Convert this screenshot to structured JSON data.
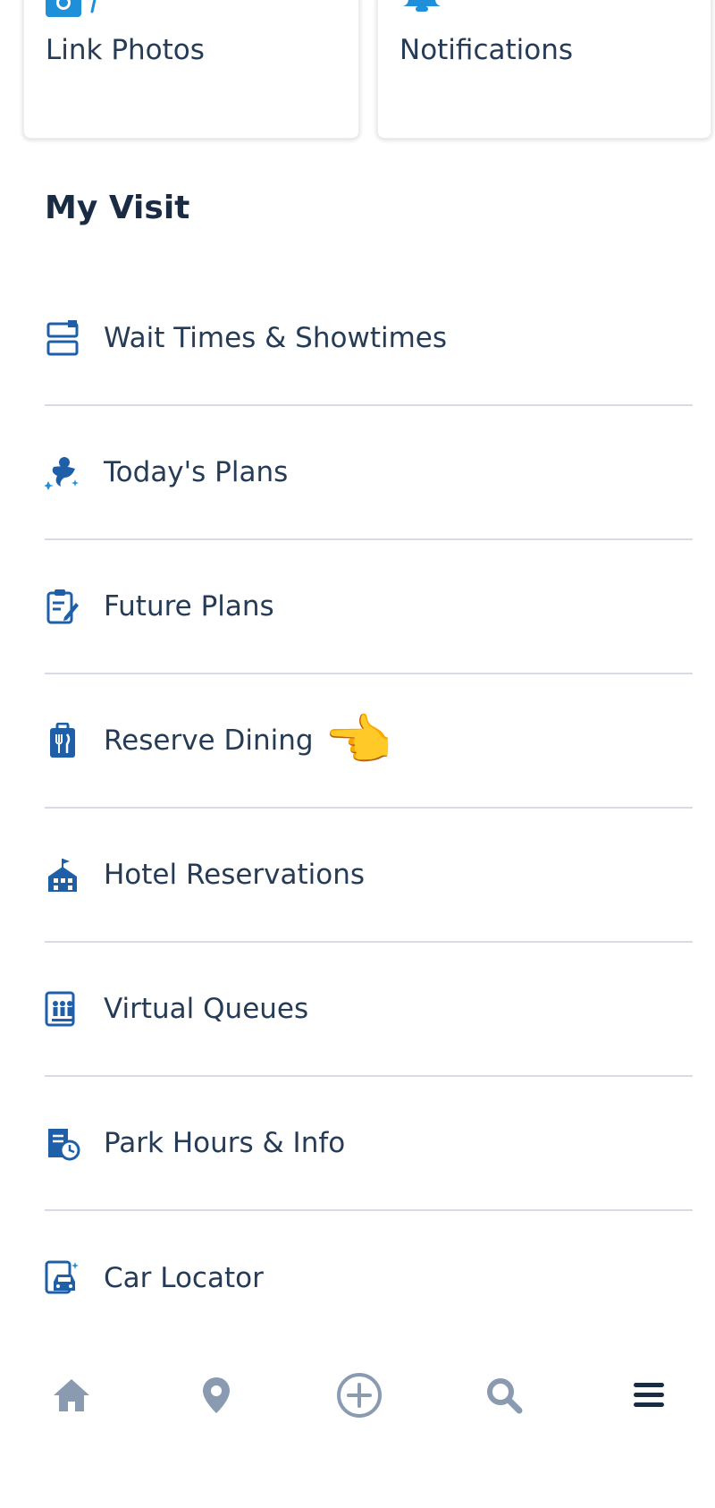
{
  "top_cards": [
    {
      "label": "Link Photos",
      "icon": "photo-link-icon"
    },
    {
      "label": "Notifications",
      "icon": "bell-icon"
    }
  ],
  "section": {
    "title": "My Visit"
  },
  "menu_items": [
    {
      "label": "Wait Times & Showtimes",
      "icon": "wait-times-icon"
    },
    {
      "label": "Today's Plans",
      "icon": "genie-icon"
    },
    {
      "label": "Future Plans",
      "icon": "clipboard-edit-icon"
    },
    {
      "label": "Reserve Dining",
      "icon": "dining-icon",
      "emoji": "👈"
    },
    {
      "label": "Hotel Reservations",
      "icon": "hotel-icon"
    },
    {
      "label": "Virtual Queues",
      "icon": "virtual-queue-icon"
    },
    {
      "label": "Park Hours & Info",
      "icon": "park-hours-icon"
    },
    {
      "label": "Car Locator",
      "icon": "car-locator-icon"
    }
  ],
  "tab_bar": [
    {
      "name": "home",
      "icon": "home-icon"
    },
    {
      "name": "map",
      "icon": "map-pin-icon"
    },
    {
      "name": "add",
      "icon": "plus-circle-icon"
    },
    {
      "name": "search",
      "icon": "search-icon"
    },
    {
      "name": "menu",
      "icon": "hamburger-menu-icon"
    }
  ],
  "colors": {
    "text_dark": "#253b56",
    "heading": "#1a2b44",
    "icon_blue": "#1f5fa8",
    "accent_blue": "#1e8fd8",
    "divider": "#d6dbe5",
    "tab_inactive": "#8a9ab0",
    "tab_active": "#1a2b44"
  }
}
